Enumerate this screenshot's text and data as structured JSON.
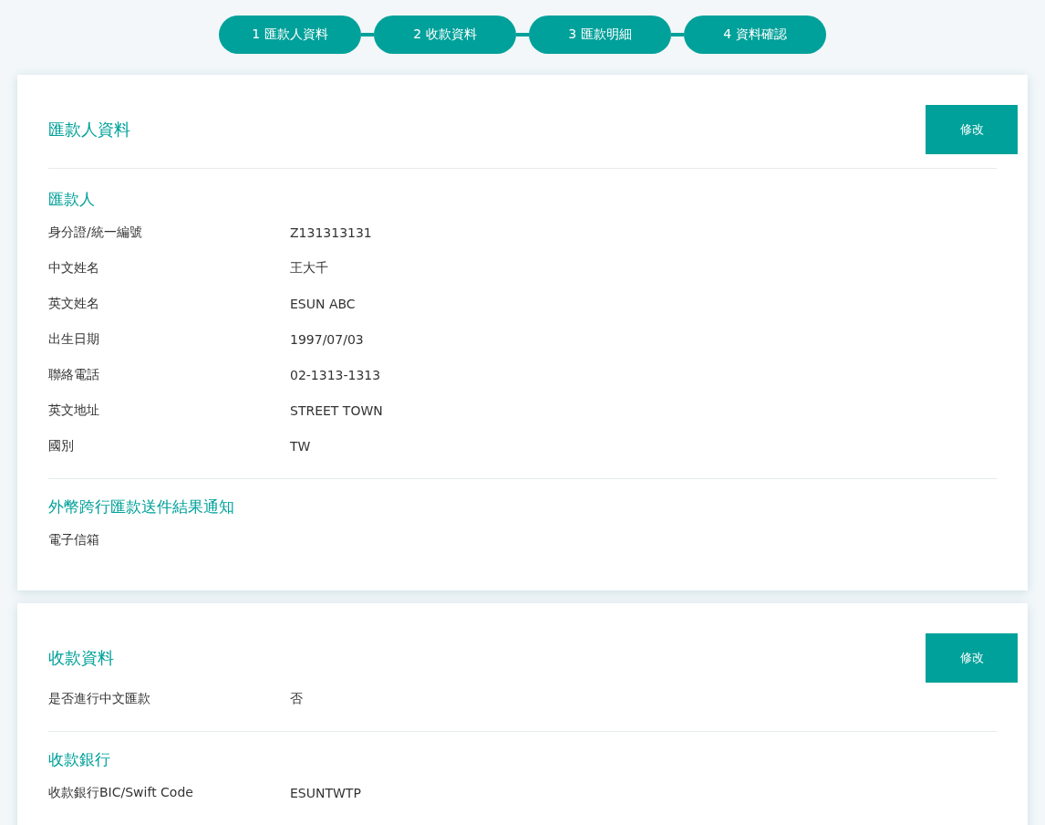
{
  "steps": [
    {
      "label": "1 匯款人資料"
    },
    {
      "label": "2 收款資料"
    },
    {
      "label": "3 匯款明細"
    },
    {
      "label": "4 資料確認"
    }
  ],
  "sections": [
    {
      "title": "匯款人資料",
      "edit_button": "修改",
      "groups": [
        {
          "heading": "匯款人",
          "rows": [
            {
              "label": "身分證/統一編號",
              "value": "Z131313131"
            },
            {
              "label": "中文姓名",
              "value": "王大千"
            },
            {
              "label": "英文姓名",
              "value": "ESUN ABC"
            },
            {
              "label": "出生日期",
              "value": "1997/07/03"
            },
            {
              "label": "聯絡電話",
              "value": "02-1313-1313"
            },
            {
              "label": "英文地址",
              "value": "STREET TOWN"
            },
            {
              "label": "國別",
              "value": "TW"
            }
          ]
        },
        {
          "heading": "外幣跨行匯款送件結果通知",
          "rows": [
            {
              "label": "電子信箱"
            }
          ]
        }
      ]
    },
    {
      "title": "收款資料",
      "edit_button": "修改",
      "groups": [
        {
          "rows": [
            {
              "label": "是否進行中文匯款",
              "value": "否"
            }
          ]
        },
        {
          "heading": "收款銀行",
          "rows": [
            {
              "label": "收款銀行BIC/Swift Code",
              "value": "ESUNTWTP"
            }
          ]
        }
      ]
    }
  ]
}
